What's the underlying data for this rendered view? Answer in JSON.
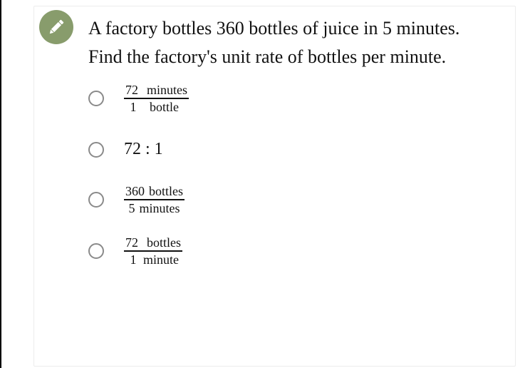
{
  "question": {
    "line1": "A factory bottles 360 bottles of juice in 5 minutes.",
    "line2": "Find the factory's unit rate of bottles per minute."
  },
  "badge_icon": "pencil-icon",
  "options": [
    {
      "type": "fraction",
      "num_value": "72",
      "num_unit": "minutes",
      "den_value": "1",
      "den_unit": "bottle",
      "selected": false
    },
    {
      "type": "ratio",
      "text": "72 : 1",
      "selected": false
    },
    {
      "type": "fraction",
      "num_value": "360",
      "num_unit": "bottles",
      "den_value": "5",
      "den_unit": "minutes",
      "selected": false
    },
    {
      "type": "fraction",
      "num_value": "72",
      "num_unit": "bottles",
      "den_value": "1",
      "den_unit": "minute",
      "selected": false
    }
  ],
  "colors": {
    "badge": "#889c6c",
    "radio_border": "#8a8a8a"
  }
}
